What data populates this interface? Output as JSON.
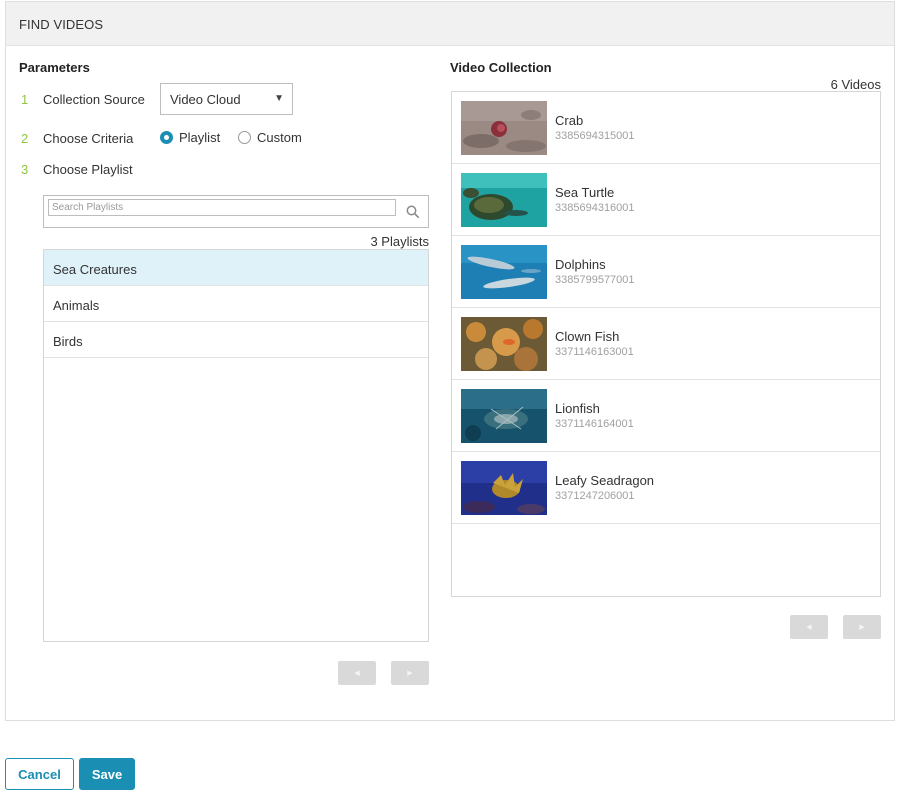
{
  "panel": {
    "title": "FIND VIDEOS"
  },
  "parameters": {
    "title": "Parameters",
    "steps": [
      {
        "num": "1",
        "label": "Collection Source"
      },
      {
        "num": "2",
        "label": "Choose Criteria"
      },
      {
        "num": "3",
        "label": "Choose Playlist"
      }
    ],
    "source_select": {
      "value": "Video Cloud",
      "arrow": "▼"
    },
    "criteria": [
      {
        "label": "Playlist",
        "checked": true
      },
      {
        "label": "Custom",
        "checked": false
      }
    ],
    "search": {
      "placeholder": "Search Playlists",
      "icon": "search-icon"
    },
    "playlist_count": "3 Playlists",
    "playlists": [
      {
        "label": "Sea Creatures",
        "selected": true
      },
      {
        "label": "Animals",
        "selected": false
      },
      {
        "label": "Birds",
        "selected": false
      }
    ],
    "pager": {
      "prev": "◀",
      "next": "▶"
    }
  },
  "collection": {
    "title": "Video Collection",
    "count": "6 Videos",
    "videos": [
      {
        "name": "Crab",
        "id": "3385694315001"
      },
      {
        "name": "Sea Turtle",
        "id": "3385694316001"
      },
      {
        "name": "Dolphins",
        "id": "3385799577001"
      },
      {
        "name": "Clown Fish",
        "id": "3371146163001"
      },
      {
        "name": "Lionfish",
        "id": "3371146164001"
      },
      {
        "name": "Leafy Seadragon",
        "id": "3371247206001"
      }
    ],
    "pager": {
      "prev": "◀",
      "next": "▶"
    }
  },
  "footer": {
    "cancel_label": "Cancel",
    "save_label": "Save"
  },
  "colors": {
    "accent": "#1a8fb3",
    "step_number": "#8dc63f",
    "selected_row": "#dff1f9"
  }
}
